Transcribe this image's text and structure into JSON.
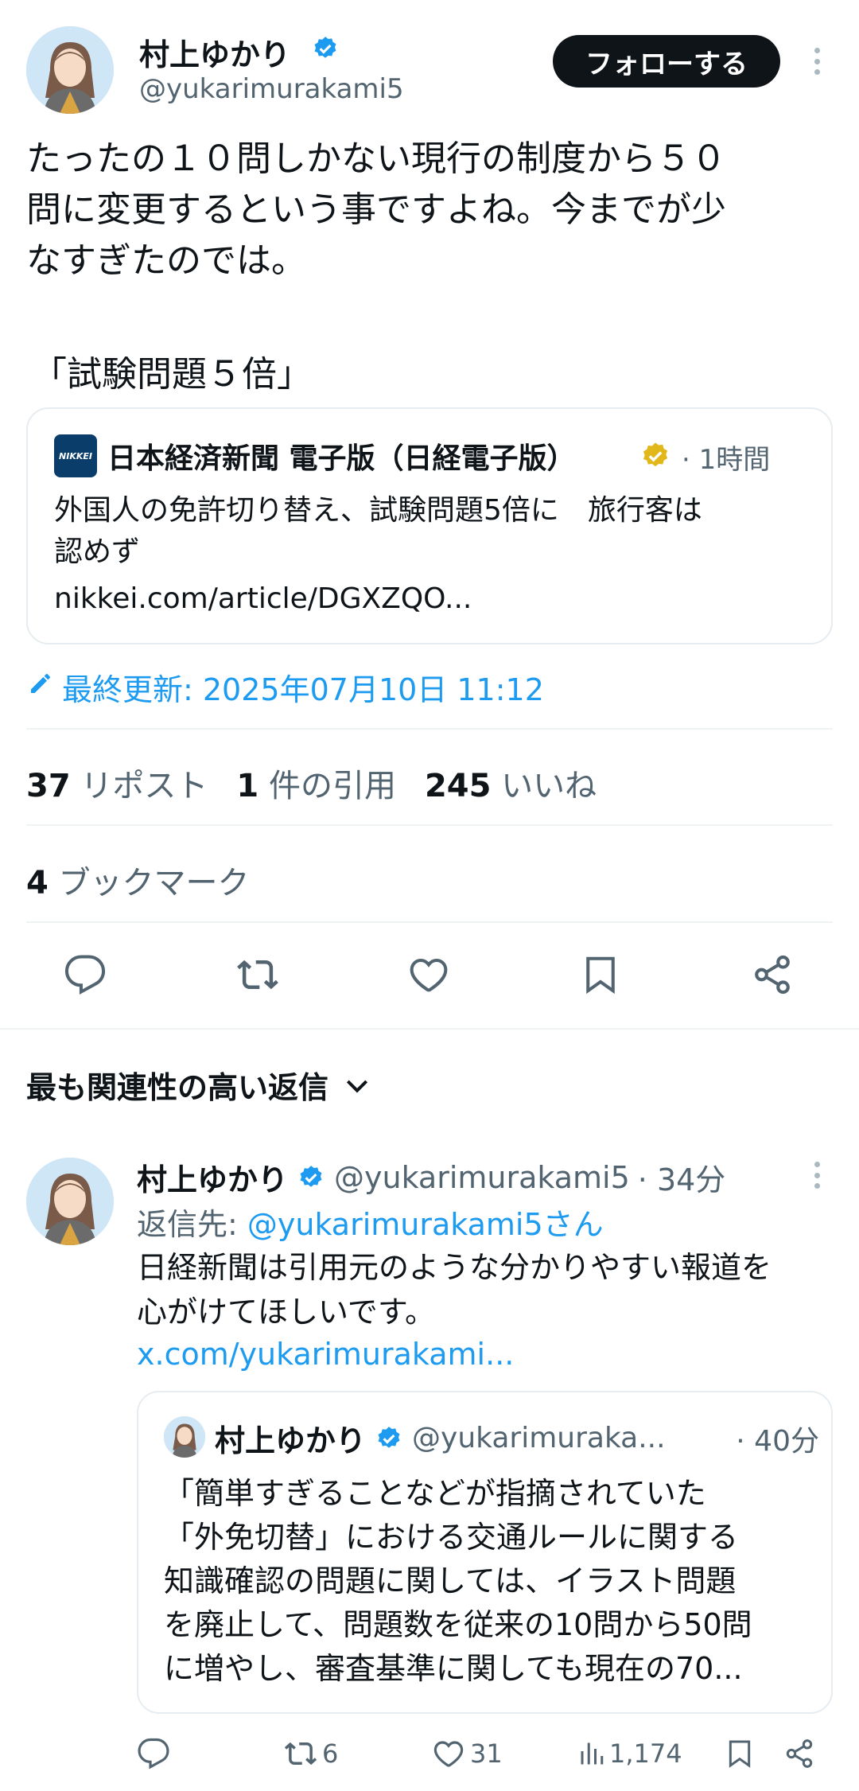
{
  "tweet": {
    "author_name": "村上ゆかり",
    "author_handle": "@yukarimurakami5",
    "follow_label": "フォローする",
    "text_line1": "たったの１０問しかない現行の制度から５０",
    "text_line2": "問に変更するという事ですよね。今までが少",
    "text_line3": "なすぎたのでは。",
    "quote_text": "「試験問題５倍」",
    "card": {
      "logo_text": "NIKKEI",
      "source_name": "日本経済新聞 電子版（日経電子版）",
      "time": "· 1時間",
      "headline_line1": "外国人の免許切り替え、試験問題5倍に　旅行客は",
      "headline_line2": "認めず",
      "link": "nikkei.com/article/DGXZQO..."
    },
    "edited": "最終更新: 2025年07月10日 11:12",
    "stats": {
      "reposts_num": "37",
      "reposts_label": "リポスト",
      "quotes_num": "1",
      "quotes_label": "件の引用",
      "likes_num": "245",
      "likes_label": "いいね",
      "bookmarks_num": "4",
      "bookmarks_label": "ブックマーク"
    }
  },
  "replies_header": "最も関連性の高い返信",
  "reply": {
    "author_name": "村上ゆかり",
    "author_handle": "@yukarimurakami5",
    "time": "· 34分",
    "reply_to_prefix": "返信先: ",
    "reply_to_handle": "@yukarimurakami5さん",
    "text_line1": "日経新聞は引用元のような分かりやすい報道を",
    "text_line2": "心がけてほしいです。",
    "link": "x.com/yukarimurakami...",
    "quoted": {
      "author_name": "村上ゆかり",
      "author_handle": "@yukarimuraka...",
      "time": "· 40分",
      "line1": "「簡単すぎることなどが指摘されていた",
      "line2": "「外免切替」における交通ルールに関する",
      "line3": "知識確認の問題に関しては、イラスト問題",
      "line4": "を廃止して、問題数を従来の10問から50問",
      "line5": "に増やし、審査基準に関しても現在の70..."
    },
    "actions": {
      "retweets": "6",
      "likes": "31",
      "views": "1,174"
    }
  },
  "colors": {
    "accent": "#1d9bf0",
    "text": "#0f1419",
    "muted": "#536471",
    "verified_gold": "#e2b719",
    "nikkei_blue": "#0b3d6b"
  }
}
